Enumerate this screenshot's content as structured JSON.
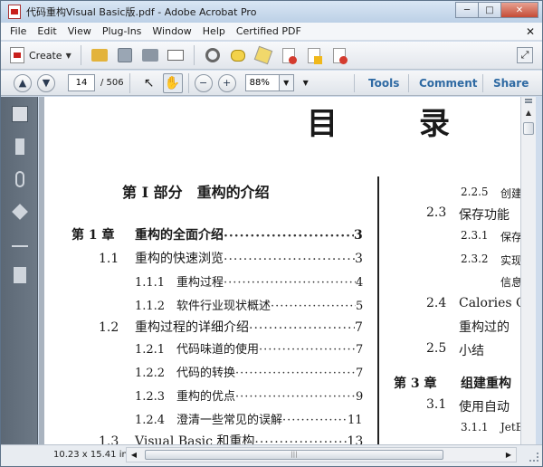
{
  "window": {
    "title": "代码重构Visual Basic版.pdf - Adobe Acrobat Pro",
    "minimize": "─",
    "maximize": "□",
    "close": "✕"
  },
  "menubar": {
    "items": [
      "File",
      "Edit",
      "View",
      "Plug-Ins",
      "Window",
      "Help",
      "Certified PDF"
    ],
    "close_glyph": "✕"
  },
  "toolbar": {
    "create_label": "Create",
    "icons": [
      "open-folder-icon",
      "save-icon",
      "print-icon",
      "email-icon",
      "settings-gear-icon",
      "comment-bubble-icon",
      "sign-pen-icon",
      "pdf-export-icon",
      "pdf-secure-icon",
      "pdf-share-icon"
    ]
  },
  "nav": {
    "page_value": "14",
    "page_total": "/ 506",
    "zoom_value": "88%",
    "tools_label": "Tools",
    "comment_label": "Comment",
    "share_label": "Share"
  },
  "document": {
    "title_left": "目",
    "title_right": "录",
    "part_heading": "第 I 部分　重构的介绍",
    "left_entries": [
      {
        "num": "第 1 章",
        "text": "重构的全面介绍",
        "page": "3"
      },
      {
        "num": "1.1",
        "text": "重构的快速浏览",
        "page": "3"
      },
      {
        "num": "1.1.1",
        "text": "重构过程",
        "page": "4"
      },
      {
        "num": "1.1.2",
        "text": "软件行业现状概述",
        "page": "5"
      },
      {
        "num": "1.2",
        "text": "重构过程的详细介绍",
        "page": "7"
      },
      {
        "num": "1.2.1",
        "text": "代码味道的使用",
        "page": "7"
      },
      {
        "num": "1.2.2",
        "text": "代码的转换",
        "page": "7"
      },
      {
        "num": "1.2.3",
        "text": "重构的优点",
        "page": "9"
      },
      {
        "num": "1.2.4",
        "text": "澄清一些常见的误解",
        "page": "11"
      },
      {
        "num": "1.3",
        "text": "Visual Basic 和重构",
        "page": "13"
      }
    ],
    "right_entries": [
      {
        "num": "2.2.5",
        "text": "创建"
      },
      {
        "num": "2.3",
        "text": "保存功能"
      },
      {
        "num": "2.3.1",
        "text": "保存"
      },
      {
        "num": "2.3.2",
        "text": "实现"
      },
      {
        "num": "",
        "text": "信息"
      },
      {
        "num": "2.4",
        "text": "Calories C"
      },
      {
        "num": "",
        "text": "重构过的"
      },
      {
        "num": "2.5",
        "text": "小结"
      },
      {
        "num": "第 3 章",
        "text": "组建重构"
      },
      {
        "num": "3.1",
        "text": "使用自动"
      },
      {
        "num": "3.1.1",
        "text": "JetB"
      }
    ]
  },
  "status": {
    "page_size": "10.23 x 15.41 in",
    "grip": "|||"
  },
  "colors": {
    "link_blue": "#2f6aa3",
    "acrobat_red": "#c8201c",
    "nav_panel": "#5c6875"
  }
}
